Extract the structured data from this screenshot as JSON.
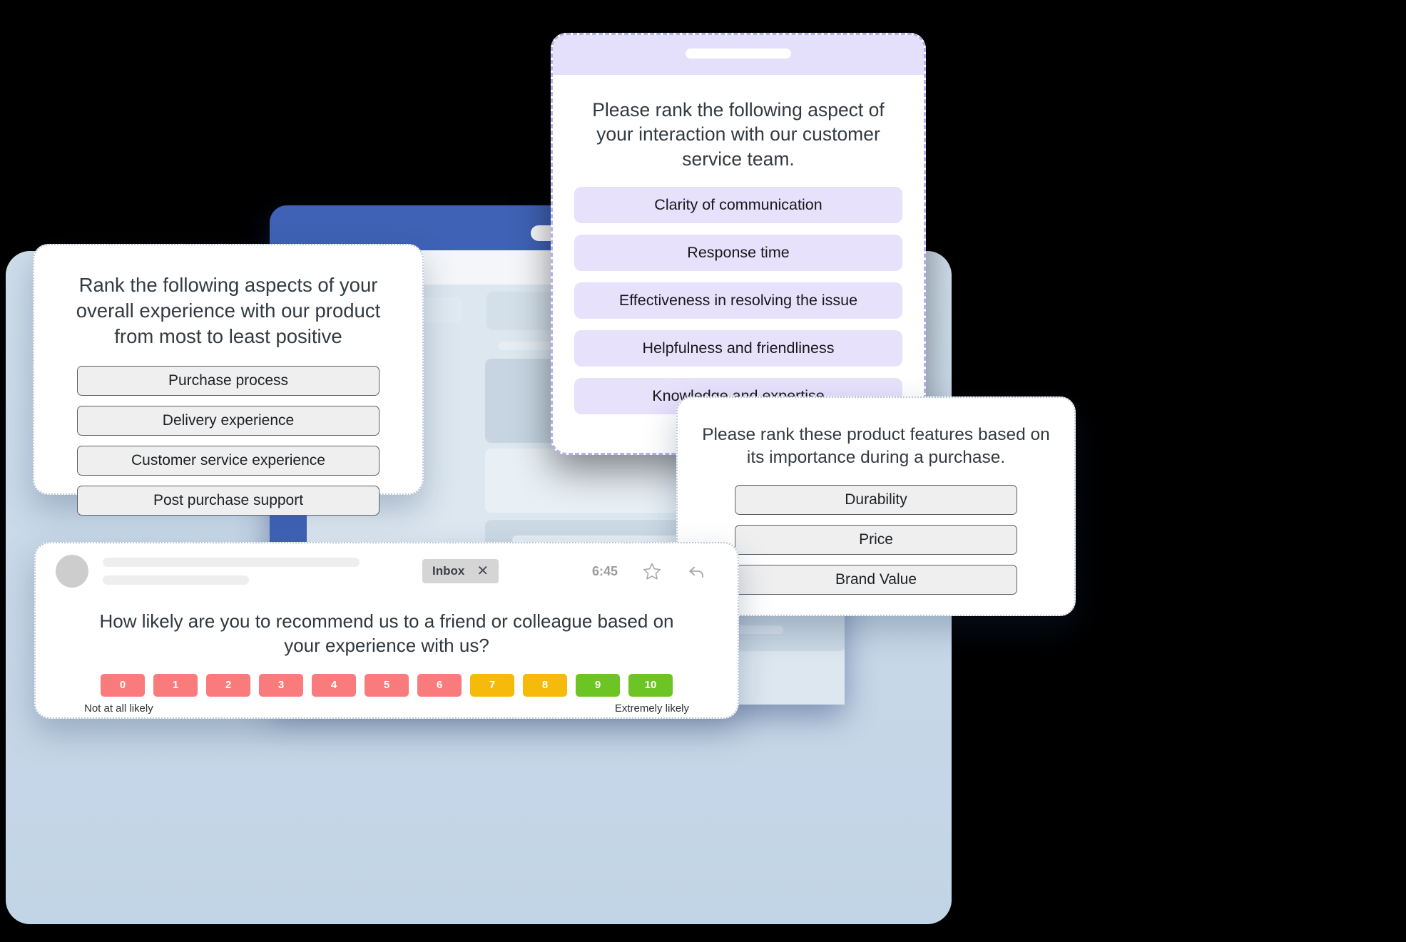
{
  "theme": {
    "background": "#000000",
    "panel_blue": "#c7d8e8",
    "browser_blue": "#3f62b6",
    "purple_row": "#e7e1fc",
    "purple_dash_border": "#b4b0ea",
    "grey_button": "#efefef",
    "grey_button_border": "#5a5f64",
    "card_border": "#b9c6d2",
    "nps_detractor": "#f97b7b",
    "nps_passive": "#f5ba0a",
    "nps_promoter": "#6cc425"
  },
  "card_experience": {
    "question": "Rank the following aspects of your overall experience with our product from most to least positive",
    "items": [
      "Purchase process",
      "Delivery experience",
      "Customer service experience",
      "Post purchase support"
    ]
  },
  "card_phone": {
    "question": "Please rank the following aspect of your interaction with our customer service team.",
    "items": [
      "Clarity of communication",
      "Response time",
      "Effectiveness in resolving the issue",
      "Helpfulness and friendliness",
      "Knowledge and expertise"
    ]
  },
  "card_features": {
    "question": "Please rank these product features based on its importance during a purchase.",
    "items": [
      "Durability",
      "Price",
      "Brand Value"
    ]
  },
  "card_nps": {
    "email": {
      "chip_label": "Inbox",
      "chip_close": "✕",
      "time": "6:45",
      "star_icon": "star-outline-icon",
      "reply_icon": "reply-arrow-icon"
    },
    "question": "How likely are you to recommend us to a friend or colleague based on your experience with us?",
    "scale": [
      {
        "value": "0",
        "color": "#f97b7b"
      },
      {
        "value": "1",
        "color": "#f97b7b"
      },
      {
        "value": "2",
        "color": "#f97b7b"
      },
      {
        "value": "3",
        "color": "#f97b7b"
      },
      {
        "value": "4",
        "color": "#f97b7b"
      },
      {
        "value": "5",
        "color": "#f97b7b"
      },
      {
        "value": "6",
        "color": "#f97b7b"
      },
      {
        "value": "7",
        "color": "#f5ba0a"
      },
      {
        "value": "8",
        "color": "#f5ba0a"
      },
      {
        "value": "9",
        "color": "#6cc425"
      },
      {
        "value": "10",
        "color": "#6cc425"
      }
    ],
    "label_low": "Not at all likely",
    "label_high": "Extremely likely"
  },
  "browser_mock": {
    "window_dots_count": 3
  }
}
